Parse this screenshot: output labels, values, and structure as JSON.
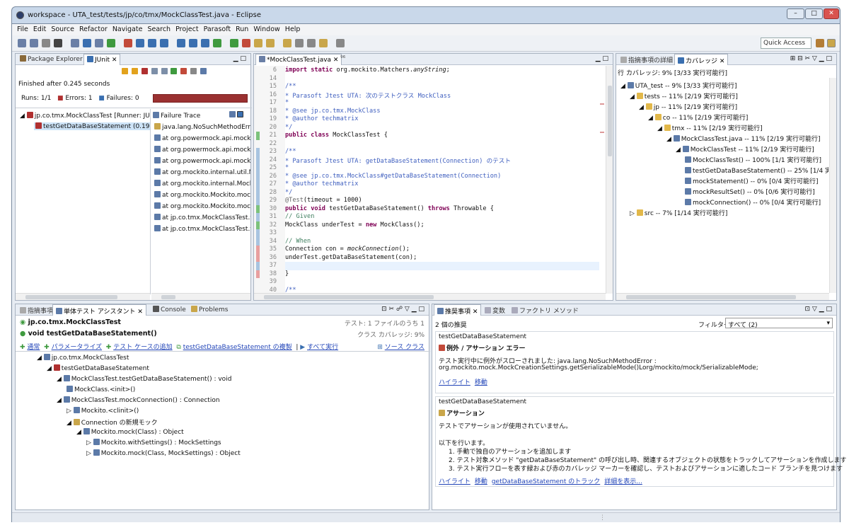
{
  "window": {
    "title": "workspace - UTA_test/tests/jp/co/tmx/MockClassTest.java - Eclipse"
  },
  "menu": [
    "File",
    "Edit",
    "Source",
    "Refactor",
    "Navigate",
    "Search",
    "Project",
    "Parasoft",
    "Run",
    "Window",
    "Help"
  ],
  "quick_access": "Quick Access",
  "left": {
    "tabs": [
      "Package Explorer",
      "JUnit"
    ],
    "finished": "Finished after 0.245 seconds",
    "runs_label": "Runs:",
    "runs": "1/1",
    "errors_label": "Errors:",
    "errors": "1",
    "failures_label": "Failures:",
    "failures": "0",
    "tree": [
      "jp.co.tmx.MockClassTest [Runner: JU",
      "testGetDataBaseStatement (0.19"
    ],
    "failure_trace_label": "Failure Trace",
    "trace": [
      "java.lang.NoSuchMethodError",
      "at org.powermock.api.mocki",
      "at org.powermock.api.mocki",
      "at org.powermock.api.mocki",
      "at org.mockito.internal.util.M",
      "at org.mockito.internal.Mock",
      "at org.mockito.Mockito.mock",
      "at org.mockito.Mockito.mock",
      "at jp.co.tmx.MockClassTest.t",
      "at jp.co.tmx.MockClassTest.t"
    ]
  },
  "editor": {
    "tab": "*MockClassTest.java",
    "lines": [
      {
        "n": "6",
        "t": [
          [
            "kw",
            "import static "
          ],
          [
            "",
            "org.mockito.Matchers."
          ],
          [
            "it",
            "anyString"
          ],
          [
            "",
            ";"
          ]
        ]
      },
      {
        "n": "14",
        "t": []
      },
      {
        "n": "15",
        "t": [
          [
            "jd",
            "/**"
          ]
        ]
      },
      {
        "n": "16",
        "t": [
          [
            "jd",
            " * Parasoft Jtest UTA: 次のテストクラス MockClass"
          ]
        ]
      },
      {
        "n": "17",
        "t": [
          [
            "jd",
            " *"
          ]
        ]
      },
      {
        "n": "18",
        "t": [
          [
            "jd",
            " * @see jp.co.tmx.MockClass"
          ]
        ]
      },
      {
        "n": "19",
        "t": [
          [
            "jd",
            " * @author techmatrix"
          ]
        ]
      },
      {
        "n": "20",
        "t": [
          [
            "jd",
            " */"
          ]
        ]
      },
      {
        "n": "21",
        "t": [
          [
            "kw",
            "public class "
          ],
          [
            "",
            "MockClassTest {"
          ]
        ]
      },
      {
        "n": "22",
        "t": []
      },
      {
        "n": "23",
        "t": [
          [
            "jd",
            "    /**"
          ]
        ]
      },
      {
        "n": "24",
        "t": [
          [
            "jd",
            "     * Parasoft Jtest UTA: getDataBaseStatement(Connection) のテスト"
          ]
        ]
      },
      {
        "n": "25",
        "t": [
          [
            "jd",
            "     *"
          ]
        ]
      },
      {
        "n": "26",
        "t": [
          [
            "jd",
            "     * @see jp.co.tmx.MockClass#getDataBaseStatement(Connection)"
          ]
        ]
      },
      {
        "n": "27",
        "t": [
          [
            "jd",
            "     * @author techmatrix"
          ]
        ]
      },
      {
        "n": "28",
        "t": [
          [
            "jd",
            "     */"
          ]
        ]
      },
      {
        "n": "29",
        "t": [
          [
            "an",
            "    @Test"
          ],
          [
            "",
            "(timeout = 1000)"
          ]
        ]
      },
      {
        "n": "30",
        "t": [
          [
            "kw",
            "    public void "
          ],
          [
            "",
            "testGetDataBaseStatement() "
          ],
          [
            "kw",
            "throws "
          ],
          [
            "",
            "Throwable {"
          ]
        ]
      },
      {
        "n": "31",
        "t": [
          [
            "cm",
            "        // Given"
          ]
        ]
      },
      {
        "n": "32",
        "t": [
          [
            "",
            "        MockClass underTest = "
          ],
          [
            "kw",
            "new "
          ],
          [
            "",
            "MockClass();"
          ]
        ]
      },
      {
        "n": "33",
        "t": []
      },
      {
        "n": "34",
        "t": [
          [
            "cm",
            "        // When"
          ]
        ]
      },
      {
        "n": "35",
        "t": [
          [
            "",
            "        Connection con = "
          ],
          [
            "it",
            "mockConnection"
          ],
          [
            "",
            "();"
          ]
        ]
      },
      {
        "n": "36",
        "t": [
          [
            "",
            "        underTest.getDataBaseStatement(con);"
          ]
        ]
      },
      {
        "n": "37",
        "t": []
      },
      {
        "n": "38",
        "t": [
          [
            "",
            "    }"
          ]
        ]
      },
      {
        "n": "39",
        "t": []
      },
      {
        "n": "40",
        "t": [
          [
            "jd",
            "    /**"
          ]
        ]
      }
    ]
  },
  "coverage": {
    "tabs": [
      "指摘事項の詳細",
      "カバレッジ"
    ],
    "summary": "行 カバレッジ: 9% [3/33 実行可能行]",
    "tree": [
      {
        "d": 0,
        "t": "UTA_test -- 9% [3/33 実行可能行]"
      },
      {
        "d": 1,
        "t": "tests -- 11% [2/19 実行可能行]"
      },
      {
        "d": 2,
        "t": "jp -- 11% [2/19 実行可能行]"
      },
      {
        "d": 3,
        "t": "co -- 11% [2/19 実行可能行]"
      },
      {
        "d": 4,
        "t": "tmx -- 11% [2/19 実行可能行]"
      },
      {
        "d": 5,
        "t": "MockClassTest.java -- 11% [2/19 実行可能行]"
      },
      {
        "d": 6,
        "t": "MockClassTest -- 11% [2/19 実行可能行]"
      },
      {
        "d": 7,
        "t": "MockClassTest() -- 100% [1/1 実行可能行]"
      },
      {
        "d": 7,
        "t": "testGetDataBaseStatement() -- 25% [1/4 実"
      },
      {
        "d": 7,
        "t": "mockStatement() -- 0% [0/4 実行可能行]"
      },
      {
        "d": 7,
        "t": "mockResultSet() -- 0% [0/6 実行可能行]"
      },
      {
        "d": 7,
        "t": "mockConnection() -- 0% [0/4 実行可能行]"
      },
      {
        "d": 1,
        "t": "src -- 7% [1/14 実行可能行]"
      }
    ]
  },
  "assistant": {
    "tabs": [
      "指摘事項",
      "単体テスト アシスタント",
      "Console",
      "Problems"
    ],
    "class": "jp.co.tmx.MockClassTest",
    "method": "void testGetDataBaseStatement()",
    "test_info": "テスト: 1 ファイルのうち 1",
    "class_cov": "クラス カバレッジ: 9%",
    "actions": [
      "通常",
      "パラメータライズ",
      "テスト ケースの追加",
      "testGetDataBaseStatement の複製",
      "すべて実行",
      "ソース クラス"
    ],
    "tree": [
      {
        "d": 0,
        "t": "jp.co.tmx.MockClassTest"
      },
      {
        "d": 1,
        "t": "testGetDataBaseStatement"
      },
      {
        "d": 2,
        "t": "MockClassTest.testGetDataBaseStatement() : void"
      },
      {
        "d": 3,
        "t": "MockClass.<init>()"
      },
      {
        "d": 2,
        "t": "MockClassTest.mockConnection() : Connection"
      },
      {
        "d": 3,
        "t": "Mockito.<clinit>()"
      },
      {
        "d": 3,
        "t": "Connection の新規モック"
      },
      {
        "d": 4,
        "t": "Mockito.mock(Class) : Object"
      },
      {
        "d": 5,
        "t": "Mockito.withSettings() : MockSettings"
      },
      {
        "d": 5,
        "t": "Mockito.mock(Class, MockSettings) : Object"
      }
    ]
  },
  "recommend": {
    "tabs": [
      "推奨事項",
      "変数",
      "ファクトリ メソッド"
    ],
    "count": "2 個の推奨",
    "filter_label": "フィルター",
    "filter_value": "すべて (2)",
    "items": [
      {
        "group": "testGetDataBaseStatement",
        "title": "例外 / アサーション エラー",
        "lines": [
          "テスト実行中に例外がスローされました: java.lang.NoSuchMethodError :",
          "org.mockito.mock.MockCreationSettings.getSerializableMode()Lorg/mockito/mock/SerializableMode;"
        ],
        "links": [
          "ハイライト",
          "移動"
        ]
      },
      {
        "group": "testGetDataBaseStatement",
        "title": "アサーション",
        "lines": [
          "テストでアサーションが使用されていません。",
          "",
          "以下を行います。",
          "1. 手動で独自のアサーションを追加します",
          "2. テスト対象メソッド \"getDataBaseStatement\" の呼び出し時、関連するオブジェクトの状態をトラックしてアサーションを作成します",
          "3. テスト実行フローを表す緑および赤のカバレッジ マーカーを確認し、テストおよびアサーションに適したコード ブランチを見つけます"
        ],
        "links": [
          "ハイライト",
          "移動",
          "getDataBaseStatement のトラック",
          "詳細を表示..."
        ]
      }
    ]
  }
}
